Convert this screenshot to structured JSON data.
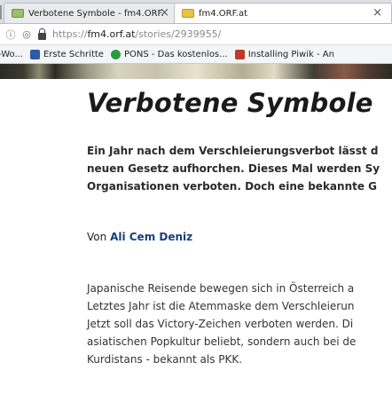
{
  "browser": {
    "tabs": [
      {
        "title": "Verbotene Symbole - fm4.ORF.",
        "close": "×"
      },
      {
        "title": "fm4.ORF.at",
        "close": "×"
      }
    ],
    "address": {
      "host": "fm4.orf.at",
      "prefix": "https://",
      "path": "/stories/2939955/"
    },
    "bookmarks": [
      {
        "label": "-Wo..."
      },
      {
        "label": "Erste Schritte"
      },
      {
        "label": "PONS - Das kostenlos..."
      },
      {
        "label": "Installing Piwik - An"
      }
    ]
  },
  "article": {
    "title": "Verbotene Symbole",
    "lead_lines": [
      "Ein Jahr nach dem Verschleierungsverbot lässt d",
      "neuen Gesetz aufhorchen. Dieses Mal werden Sy",
      "Organisationen verboten. Doch eine bekannte G"
    ],
    "byline_prefix": "Von",
    "author": "Ali Cem Deniz",
    "body_lines": [
      "Japanische Reisende bewegen sich in Österreich a",
      "Letztes Jahr ist die Atemmaske dem Verschleierun",
      "Jetzt soll das Victory-Zeichen verboten werden. Di",
      "asiatischen Popkultur beliebt, sondern auch bei de",
      "Kurdistans - bekannt als PKK."
    ]
  }
}
